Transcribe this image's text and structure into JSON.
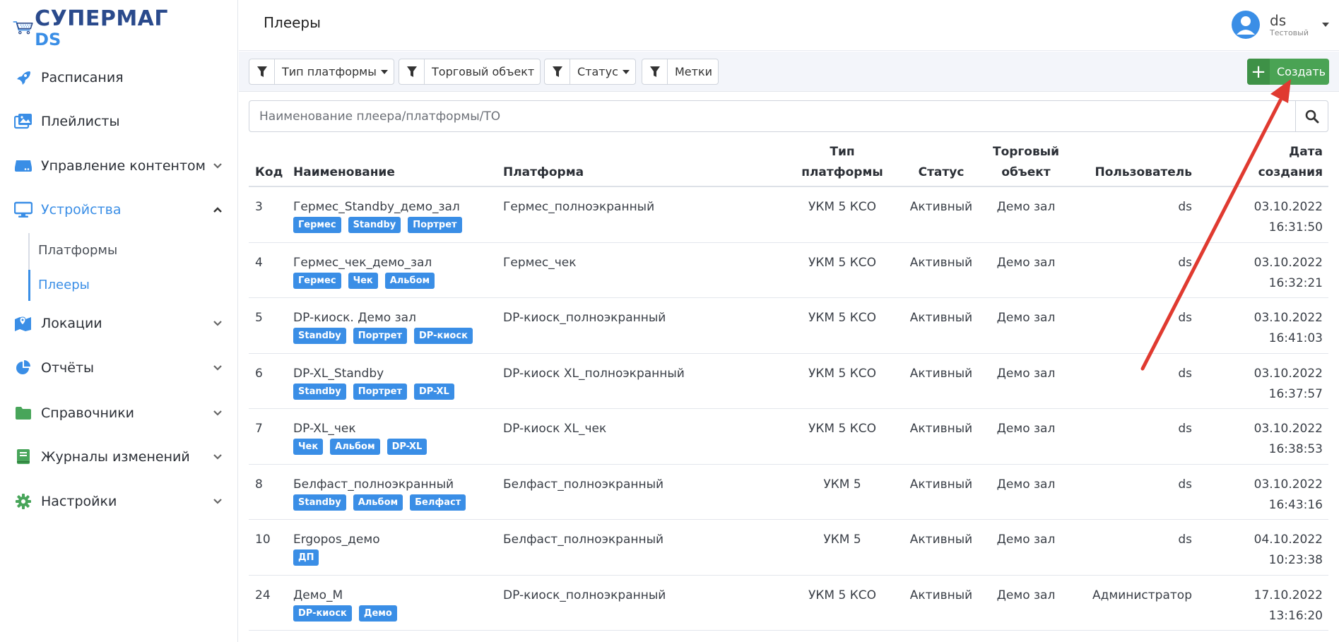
{
  "logo": {
    "line1": "СУПЕРМАГ",
    "line2": "DS"
  },
  "sidebar": {
    "items": [
      {
        "label": "Расписания",
        "icon": "rocket-icon"
      },
      {
        "label": "Плейлисты",
        "icon": "images-icon"
      },
      {
        "label": "Управление контентом",
        "icon": "hdd-icon"
      },
      {
        "label": "Устройства",
        "icon": "monitor-icon"
      },
      {
        "label": "Локации",
        "icon": "map-icon"
      },
      {
        "label": "Отчёты",
        "icon": "pie-chart-icon"
      },
      {
        "label": "Справочники",
        "icon": "folder-icon"
      },
      {
        "label": "Журналы изменений",
        "icon": "book-icon"
      },
      {
        "label": "Настройки",
        "icon": "gear-icon"
      }
    ],
    "sub": [
      "Платформы",
      "Плееры"
    ]
  },
  "header": {
    "title": "Плееры"
  },
  "user": {
    "name": "ds",
    "role": "Тестовый"
  },
  "toolbar": {
    "filters": [
      "Тип платформы",
      "Торговый объект",
      "Статус",
      "Метки"
    ],
    "create_label": "Создать"
  },
  "search": {
    "placeholder": "Наименование плеера/платформы/ТО"
  },
  "table": {
    "headers": {
      "code": "Код",
      "name": "Наименование",
      "platform": "Платформа",
      "ptype1": "Тип",
      "ptype2": "платформы",
      "status": "Статус",
      "to1": "Торговый",
      "to2": "объект",
      "user": "Пользователь",
      "date1": "Дата",
      "date2": "создания"
    },
    "rows": [
      {
        "code": "3",
        "name": "Гермес_Standby_демо_зал",
        "tags": [
          "Гермес",
          "Standby",
          "Портрет"
        ],
        "platform": "Гермес_полноэкранный",
        "ptype": "УКМ 5 КСО",
        "status": "Активный",
        "to": "Демо зал",
        "user": "ds",
        "date": "03.10.2022",
        "time": "16:31:50"
      },
      {
        "code": "4",
        "name": "Гермес_чек_демо_зал",
        "tags": [
          "Гермес",
          "Чек",
          "Альбом"
        ],
        "platform": "Гермес_чек",
        "ptype": "УКМ 5 КСО",
        "status": "Активный",
        "to": "Демо зал",
        "user": "ds",
        "date": "03.10.2022",
        "time": "16:32:21"
      },
      {
        "code": "5",
        "name": "DP-киоск. Демо зал",
        "tags": [
          "Standby",
          "Портрет",
          "DP-киоск"
        ],
        "platform": "DP-киоск_полноэкранный",
        "ptype": "УКМ 5 КСО",
        "status": "Активный",
        "to": "Демо зал",
        "user": "ds",
        "date": "03.10.2022",
        "time": "16:41:03"
      },
      {
        "code": "6",
        "name": "DP-XL_Standby",
        "tags": [
          "Standby",
          "Портрет",
          "DP-XL"
        ],
        "platform": "DP-киоск XL_полноэкранный",
        "ptype": "УКМ 5 КСО",
        "status": "Активный",
        "to": "Демо зал",
        "user": "ds",
        "date": "03.10.2022",
        "time": "16:37:57"
      },
      {
        "code": "7",
        "name": "DP-XL_чек",
        "tags": [
          "Чек",
          "Альбом",
          "DP-XL"
        ],
        "platform": "DP-киоск XL_чек",
        "ptype": "УКМ 5 КСО",
        "status": "Активный",
        "to": "Демо зал",
        "user": "ds",
        "date": "03.10.2022",
        "time": "16:38:53"
      },
      {
        "code": "8",
        "name": "Белфаст_полноэкранный",
        "tags": [
          "Standby",
          "Альбом",
          "Белфаст"
        ],
        "platform": "Белфаст_полноэкранный",
        "ptype": "УКМ 5",
        "status": "Активный",
        "to": "Демо зал",
        "user": "ds",
        "date": "03.10.2022",
        "time": "16:43:16"
      },
      {
        "code": "10",
        "name": "Ergopos_демо",
        "tags": [
          "ДП"
        ],
        "platform": "Белфаст_полноэкранный",
        "ptype": "УКМ 5",
        "status": "Активный",
        "to": "Демо зал",
        "user": "ds",
        "date": "04.10.2022",
        "time": "10:23:38"
      },
      {
        "code": "24",
        "name": "Демо_М",
        "tags": [
          "DP-киоск",
          "Демо"
        ],
        "platform": "DP-киоск_полноэкранный",
        "ptype": "УКМ 5 КСО",
        "status": "Активный",
        "to": "Демо зал",
        "user": "Администратор",
        "date": "17.10.2022",
        "time": "13:16:20"
      }
    ]
  },
  "colors": {
    "accent": "#3a8ee6",
    "create": "#4aa354",
    "arrow": "#e03a30",
    "logo_dark": "#2a4a8c"
  }
}
